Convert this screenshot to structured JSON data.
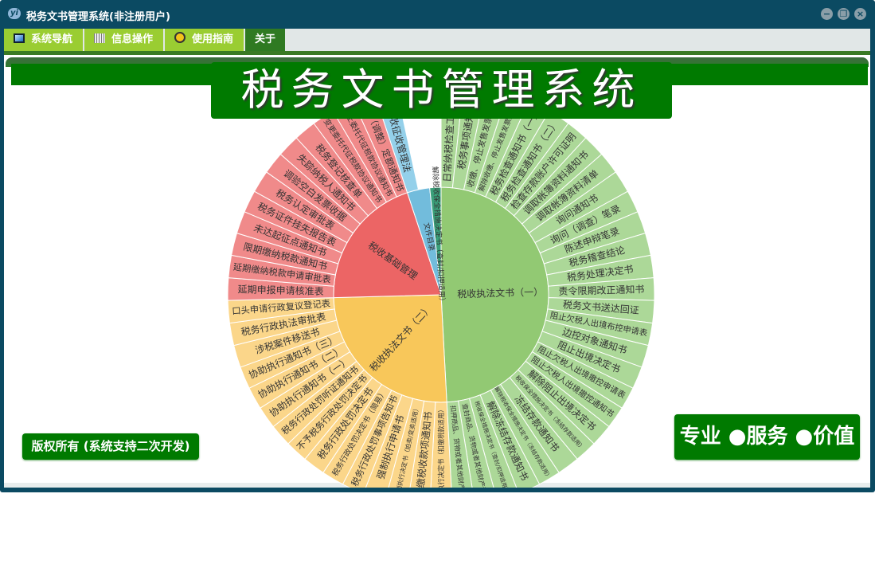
{
  "window": {
    "title": "税务文书管理系统(非注册用户)",
    "logo": "yi",
    "minimize": "−",
    "restore": "❐",
    "close": "×"
  },
  "menu": [
    {
      "label": "系统导航",
      "icon": "monitor-icon"
    },
    {
      "label": "信息操作",
      "icon": "grid-icon"
    },
    {
      "label": "使用指南",
      "icon": "help-icon"
    },
    {
      "label": "关于",
      "icon": ""
    }
  ],
  "banner": {
    "title": "税务文书管理系统"
  },
  "footer": {
    "copyright": "版权所有 (系统支持二次开发)",
    "slogan": "专业 ●服务 ●价值"
  },
  "chart_data": {
    "type": "sunburst",
    "start": "top",
    "direction": "clockwise",
    "nodes": [
      {
        "name": "税收执法文书（一）",
        "color": "#92c973",
        "childColor": "#acd898",
        "children": [
          "日常纳税检查工作底稿",
          "税务事项通知书",
          "收缴、停止发售发票决定书",
          "解除收缴、停止发售发票决定书",
          "税务检查通知书（一）",
          "税务检查通知书（二）",
          "检查存款账户许可证明",
          "调取帐簿资料通知书",
          "调取帐簿资料清单",
          "询问通知书",
          "询问（调查）笔录",
          "陈述申辩笔录",
          "税务稽查结论",
          "税务处理决定书",
          "责令限期改正通知书",
          "税务文书送达回证",
          "阻止欠税人出境布控申请表",
          "边控对象通知书",
          "阻止出境决定书",
          "阻止欠税人出境撤控申请表",
          "阻止欠税人出境撤控通知书",
          "解除阻止出境决定书",
          "税收保全措施决定书（冻结存款适用）",
          "冻结存款通知书",
          "解除税收保全措施决定书（冻结存款适用）",
          "解除冻结存款通知书",
          "税收保全措施决定书（查封/扣押适用）",
          "查封商品、货物或者其他财产清单",
          "扣押商品、货物或者其他财产清单"
        ]
      },
      {
        "name": "税收执法文书（二）",
        "color": "#f8c75a",
        "childColor": "#fbd68a",
        "children": [
          "强制执行决定书（扣缴税款适用）",
          "扣缴税收款项通知书",
          "强制执行决定书（拍卖/变卖适用）",
          "强制执行申请书",
          "税务行政处罚事项告知书",
          "税务行政处罚决定书（简易）",
          "税务行政处罚决定书",
          "不予税务行政处罚决定书",
          "税务行政处罚听证通知书",
          "协助执行通知书（一）",
          "协助执行通知书（二）",
          "协助执行通知书（三）",
          "涉税案件移送书",
          "税务行政执法审批表",
          "口头申请行政复议登记表"
        ]
      },
      {
        "name": "税收基础管理",
        "color": "#ec6565",
        "childColor": "#f08a8a",
        "children": [
          "延期申报申请核准表",
          "延期缴纳税款申请审批表",
          "限期缴纳税款通知书",
          "未达起征点通知书",
          "税务证件挂失报告表",
          "税务认定审批表",
          "调验空白发票收据",
          "失踪纳税人通知书",
          "税务登记核查单",
          "变更委托代征税款协议通知书",
          "终止委托代征税款协议通知书",
          "核定（调整）定额通知书"
        ]
      },
      {
        "name": "文件目录",
        "color": "#72bcdc",
        "childColor": "#94d0ea",
        "value": 2,
        "children": [
          "税收征收管理法"
        ]
      },
      {
        "name": "解除税收保全措施决定书（查封/扣押适用）",
        "color": "#3aa07a",
        "childColor": "#3aa07a",
        "value": 1,
        "children": []
      }
    ]
  }
}
